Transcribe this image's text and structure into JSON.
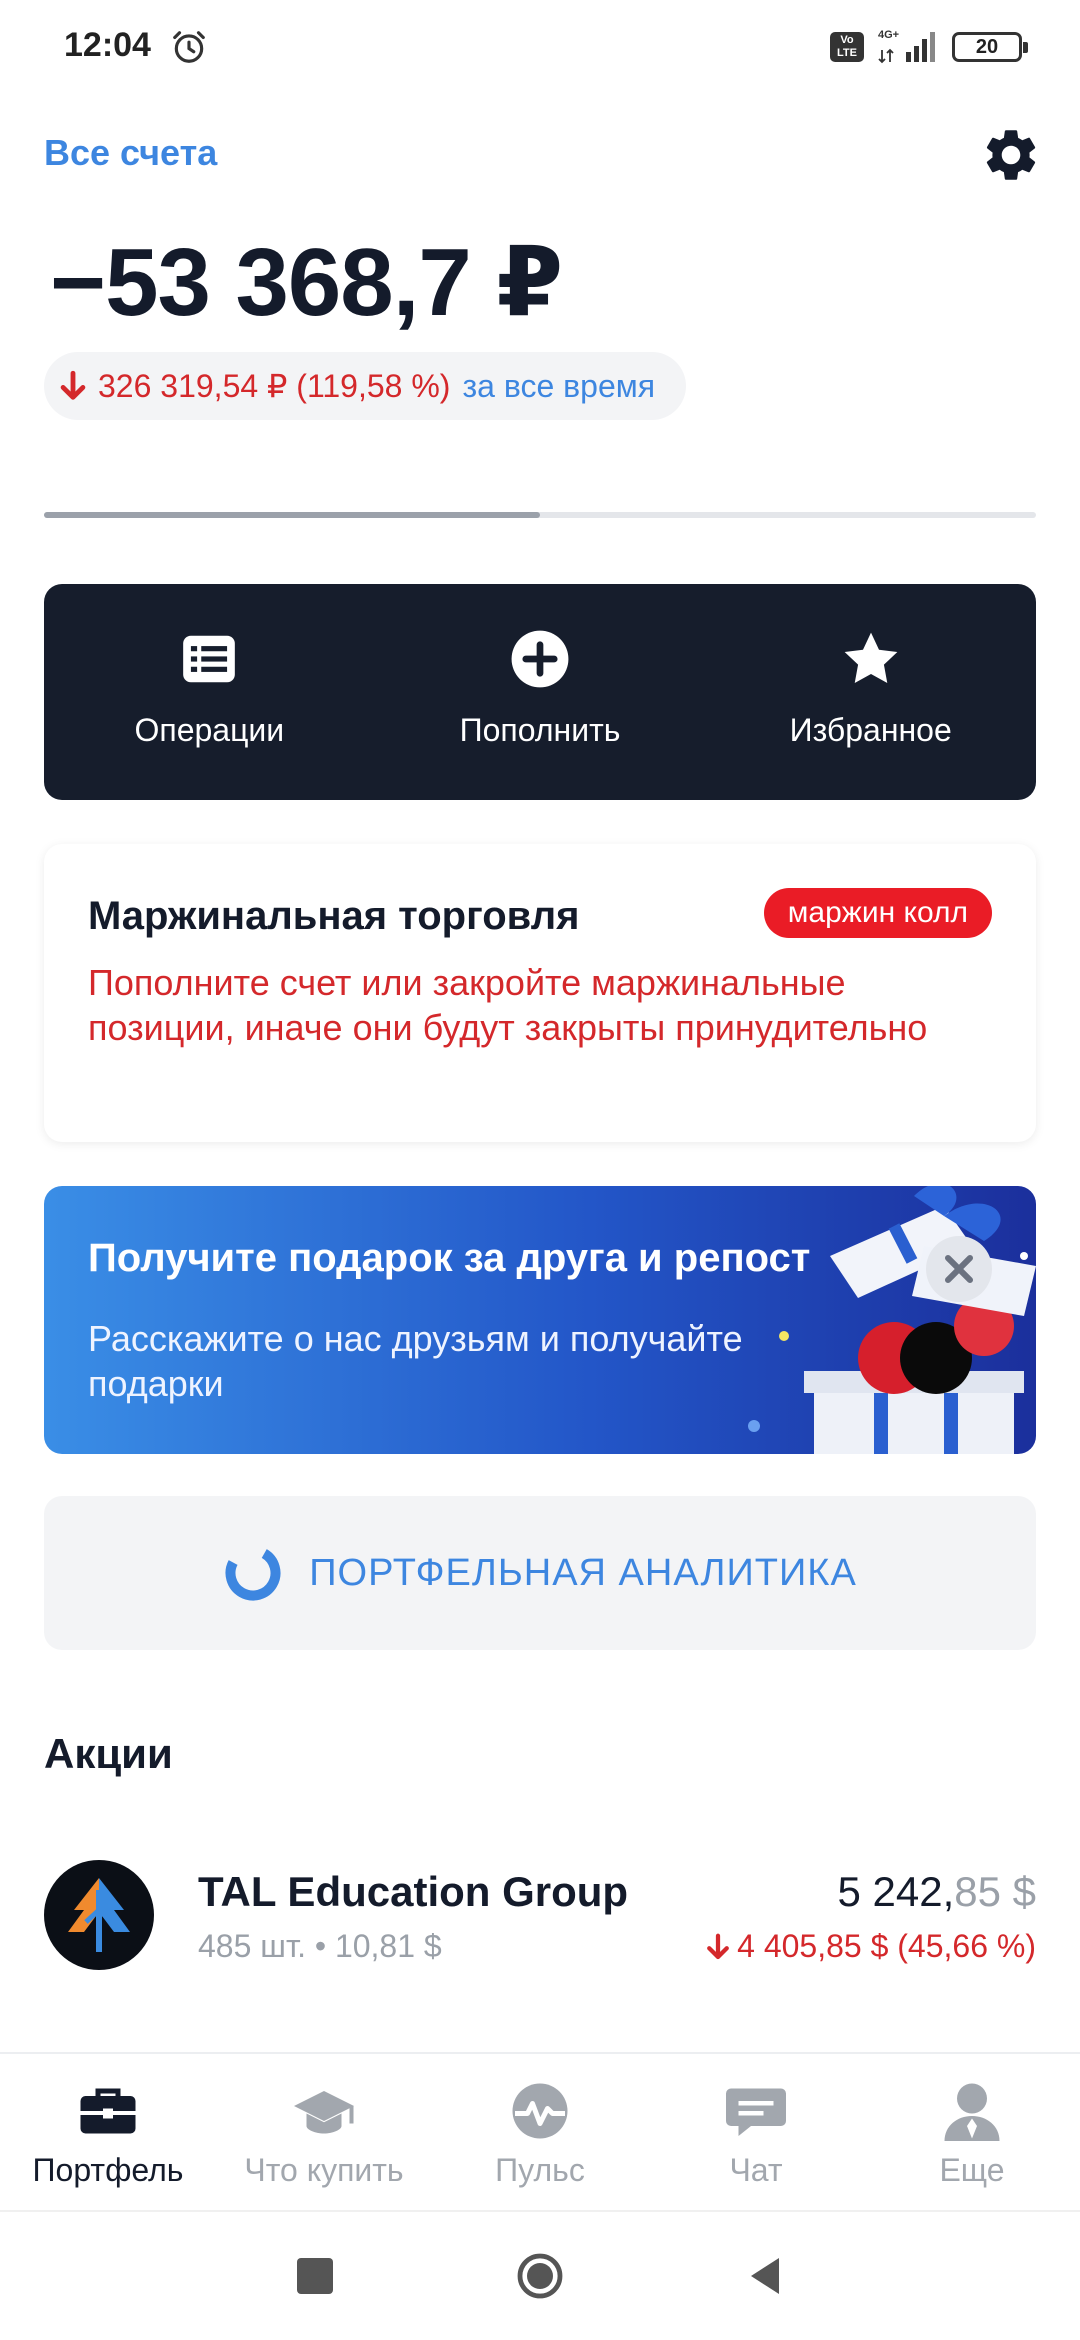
{
  "status_bar": {
    "time": "12:04",
    "volte_label": "Vo LTE",
    "network": "4G+",
    "battery": "20"
  },
  "header": {
    "all_accounts": "Все счета",
    "balance": "−53 368,7 ₽",
    "change_value": "326 319,54 ₽ (119,58 %)",
    "change_period": "за все время",
    "progress_fraction": 0.5
  },
  "actions": [
    {
      "label": "Операции",
      "icon": "list-icon"
    },
    {
      "label": "Пополнить",
      "icon": "plus-circle-icon"
    },
    {
      "label": "Избранное",
      "icon": "star-icon"
    }
  ],
  "margin_card": {
    "title": "Маржинальная торговля",
    "badge": "маржин колл",
    "text": "Пополните счет или закройте маржинальные позиции, иначе они будут закрыты принудительно"
  },
  "promo": {
    "title": "Получите подарок за друга и репост",
    "text": "Расскажите о нас друзьям и получайте подарки"
  },
  "analytics": {
    "label": "ПОРТФЕЛЬНАЯ АНАЛИТИКА"
  },
  "stocks": {
    "title": "Акции",
    "items": [
      {
        "name": "TAL Education Group",
        "qty": "485 шт. • 10,81 $",
        "value_main": "5 242,",
        "value_frac": "85 $",
        "change": "4 405,85 $ (45,66 %)"
      }
    ]
  },
  "bottom_nav": [
    {
      "label": "Портфель",
      "icon": "briefcase-icon",
      "active": true
    },
    {
      "label": "Что купить",
      "icon": "graduation-cap-icon",
      "active": false
    },
    {
      "label": "Пульс",
      "icon": "pulse-icon",
      "active": false
    },
    {
      "label": "Чат",
      "icon": "chat-icon",
      "active": false
    },
    {
      "label": "Еще",
      "icon": "user-icon",
      "active": false
    }
  ],
  "colors": {
    "accent": "#3d86e0",
    "negative": "#d4282b",
    "dark_panel": "#161d2c",
    "badge": "#ea1c26"
  }
}
